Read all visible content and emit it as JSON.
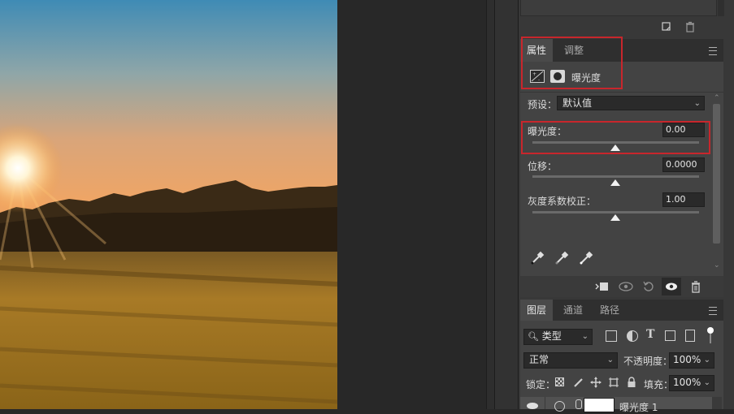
{
  "properties_panel": {
    "tabs": [
      {
        "label": "属性",
        "active": true
      },
      {
        "label": "调整",
        "active": false
      }
    ],
    "header_title": "曝光度",
    "preset_label": "预设：",
    "preset_value": "默认值",
    "controls": [
      {
        "label": "曝光度：",
        "value": "0.00",
        "slider_fraction": 0.5
      },
      {
        "label": "位移：",
        "value": "0.0000",
        "slider_fraction": 0.5
      },
      {
        "label": "灰度系数校正：",
        "value": "1.00",
        "slider_fraction": 0.5
      }
    ],
    "eyedroppers": [
      "black-point-eyedropper-icon",
      "gray-point-eyedropper-icon",
      "white-point-eyedropper-icon"
    ],
    "footer_icons": [
      "clip-to-layer-icon",
      "view-previous-state-icon",
      "reset-icon",
      "visibility-eye-icon",
      "trash-icon"
    ]
  },
  "layers_panel": {
    "tabs": [
      {
        "label": "图层",
        "active": true
      },
      {
        "label": "通道",
        "active": false
      },
      {
        "label": "路径",
        "active": false
      }
    ],
    "filter_label": "类型",
    "blend_mode": "正常",
    "opacity_label": "不透明度：",
    "opacity_value": "100%",
    "lock_label": "锁定：",
    "fill_label": "填充：",
    "fill_value": "100%",
    "layer_name": "曝光度 1"
  },
  "highlight_color": "#c8262c"
}
